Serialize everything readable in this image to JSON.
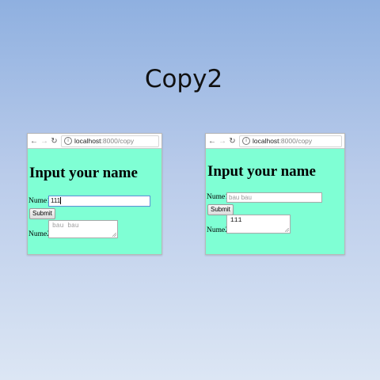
{
  "slide": {
    "title": "Copy2"
  },
  "left_window": {
    "url_host": "localhost",
    "url_path": ":8000/copy",
    "heading": "Input your name",
    "nume1_label": "Nume1",
    "nume1_value": "111",
    "submit_label": "Submit",
    "nume2_label": "Nume2",
    "nume2_placeholder": "bau bau"
  },
  "right_window": {
    "url_host": "localhost",
    "url_path": ":8000/copy",
    "heading": "Input your name",
    "nume1_label": "Nume1",
    "nume1_placeholder": "bau bau",
    "submit_label": "Submit",
    "nume2_label": "Nume2",
    "nume2_value": "111"
  },
  "colors": {
    "page_background": "#7fffd4",
    "slide_gradient_top": "#8fb0e0",
    "slide_gradient_bottom": "#dce6f4"
  },
  "icons": [
    "back-arrow-icon",
    "forward-arrow-icon",
    "reload-icon",
    "info-icon"
  ]
}
